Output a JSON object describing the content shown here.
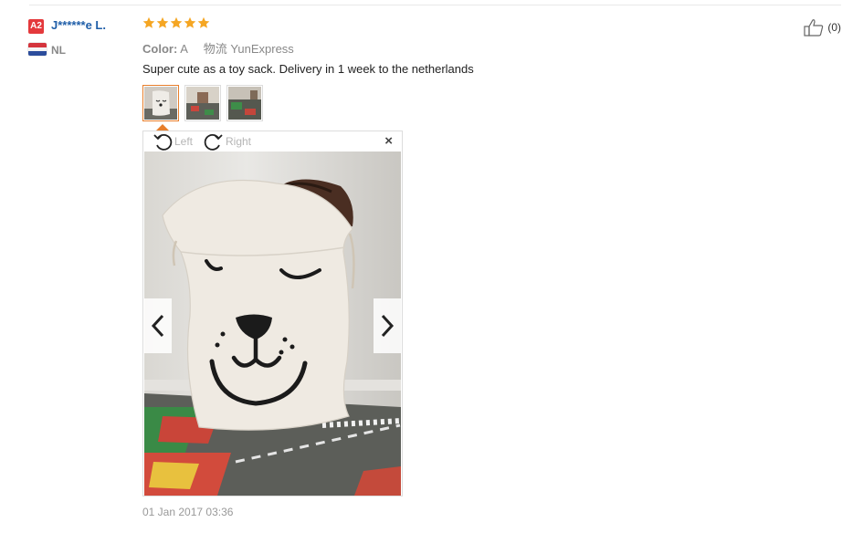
{
  "reviewer": {
    "level_badge": "A2",
    "name": "J******e L.",
    "country_code": "NL"
  },
  "rating": {
    "stars": 5,
    "color": "#f5a623"
  },
  "meta": {
    "color_label": "Color:",
    "color_value": "A",
    "shipping_label": "物流",
    "shipping_value": "YunExpress"
  },
  "review": {
    "text": "Super cute as a toy sack. Delivery in 1 week to the netherlands",
    "date": "01 Jan 2017 03:36"
  },
  "helpful": {
    "count": "(0)"
  },
  "thumbnails": [
    {
      "name": "photo-1",
      "active": true
    },
    {
      "name": "photo-2",
      "active": false
    },
    {
      "name": "photo-3",
      "active": false
    }
  ],
  "viewer": {
    "rotate_left_label": "Left",
    "rotate_right_label": "Right",
    "close_glyph": "×"
  },
  "colors": {
    "accent": "#e77e2b",
    "link": "#1f5ea8",
    "badge": "#e4393c"
  }
}
